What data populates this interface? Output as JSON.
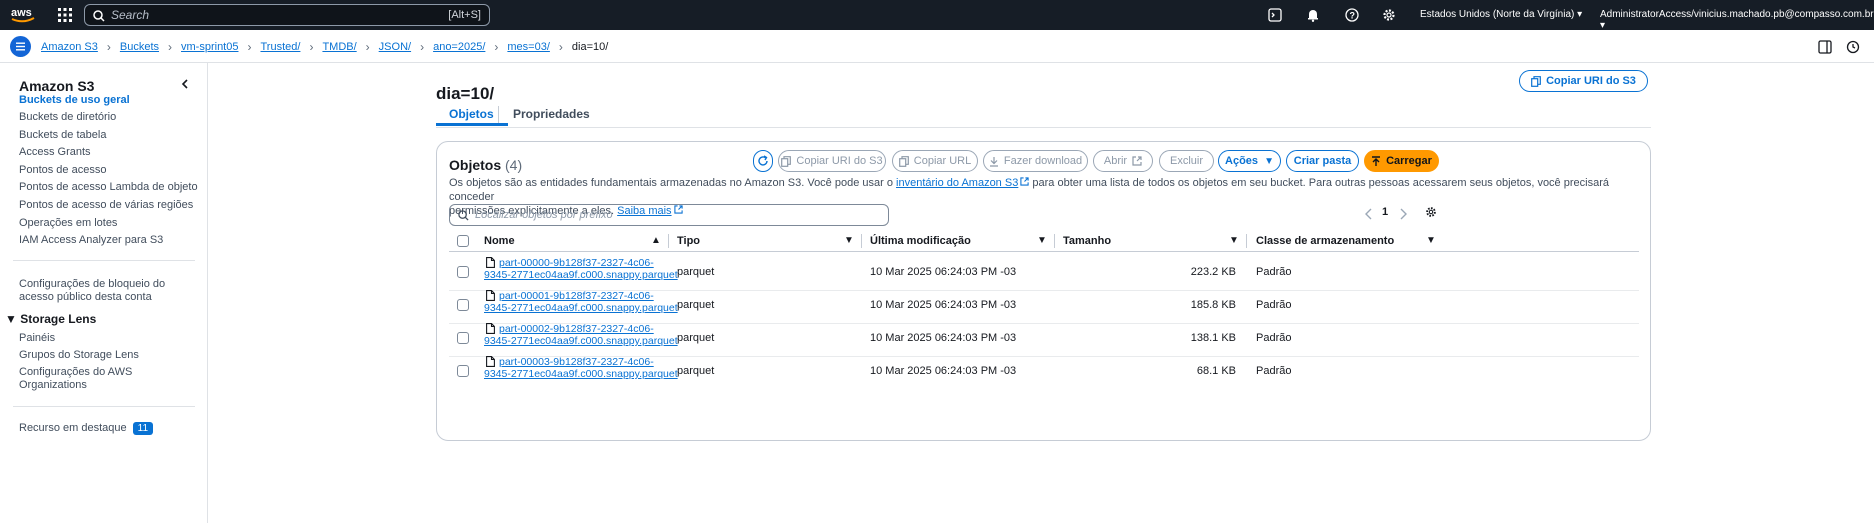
{
  "topbar": {
    "search_placeholder": "Search",
    "search_shortcut": "[Alt+S]",
    "region": "Estados Unidos (Norte da Virgínia)",
    "account": "AdministratorAccess/vinicius.machado.pb@compasso.com.br"
  },
  "breadcrumbs": [
    "Amazon S3",
    "Buckets",
    "vm-sprint05",
    "Trusted/",
    "TMDB/",
    "JSON/",
    "ano=2025/",
    "mes=03/"
  ],
  "breadcrumb_current": "dia=10/",
  "sidebar": {
    "title": "Amazon S3",
    "items": [
      {
        "label": "Buckets de uso geral",
        "active": true
      },
      {
        "label": "Buckets de diretório"
      },
      {
        "label": "Buckets de tabela"
      },
      {
        "label": "Access Grants"
      },
      {
        "label": "Pontos de acesso"
      },
      {
        "label": "Pontos de acesso Lambda de objeto"
      },
      {
        "label": "Pontos de acesso de várias regiões"
      },
      {
        "label": "Operações em lotes"
      },
      {
        "label": "IAM Access Analyzer para S3"
      }
    ],
    "block_line1": "Configurações de bloqueio do",
    "block_line2": "acesso público desta conta",
    "storage_lens": {
      "title": "Storage Lens",
      "items": [
        "Painéis",
        "Grupos do Storage Lens"
      ],
      "config_line1": "Configurações do AWS",
      "config_line2": "Organizations"
    },
    "featured": {
      "label": "Recurso em destaque",
      "count": "11"
    }
  },
  "page": {
    "title": "dia=10/",
    "copy_uri_button": "Copiar URI do S3",
    "tabs": [
      "Objetos",
      "Propriedades"
    ]
  },
  "objects": {
    "title": "Objetos",
    "count": "(4)",
    "buttons": {
      "copy_uri": "Copiar URI do S3",
      "copy_url": "Copiar URL",
      "download": "Fazer download",
      "open": "Abrir",
      "delete": "Excluir",
      "actions": "Ações",
      "create_folder": "Criar pasta",
      "upload": "Carregar"
    },
    "desc1": "Os objetos são as entidades fundamentais armazenadas no Amazon S3. Você pode usar o ",
    "desc_link": "inventário do Amazon S3",
    "desc2": " para obter uma lista de todos os objetos em seu bucket. Para outras pessoas acessarem seus objetos, você precisará conceder",
    "desc3": "permissões explicitamente a eles. ",
    "desc_learn": "Saiba mais",
    "filter_placeholder": "Localizar objetos por prefixo",
    "page_number": "1",
    "columns": [
      "Nome",
      "Tipo",
      "Última modificação",
      "Tamanho",
      "Classe de armazenamento"
    ],
    "rows": [
      {
        "name1": "part-00000-9b128f37-2327-4c06-",
        "name2": "9345-2771ec04aa9f.c000.snappy.parquet",
        "type": "parquet",
        "modified": "10 Mar 2025 06:24:03 PM -03",
        "size": "223.2 KB",
        "class": "Padrão"
      },
      {
        "name1": "part-00001-9b128f37-2327-4c06-",
        "name2": "9345-2771ec04aa9f.c000.snappy.parquet",
        "type": "parquet",
        "modified": "10 Mar 2025 06:24:03 PM -03",
        "size": "185.8 KB",
        "class": "Padrão"
      },
      {
        "name1": "part-00002-9b128f37-2327-4c06-",
        "name2": "9345-2771ec04aa9f.c000.snappy.parquet",
        "type": "parquet",
        "modified": "10 Mar 2025 06:24:03 PM -03",
        "size": "138.1 KB",
        "class": "Padrão"
      },
      {
        "name1": "part-00003-9b128f37-2327-4c06-",
        "name2": "9345-2771ec04aa9f.c000.snappy.parquet",
        "type": "parquet",
        "modified": "10 Mar 2025 06:24:03 PM -03",
        "size": "68.1 KB",
        "class": "Padrão"
      }
    ]
  },
  "colors": {
    "accent": "#0972d3",
    "topbar": "#161d26",
    "primary": "#ff9900"
  }
}
